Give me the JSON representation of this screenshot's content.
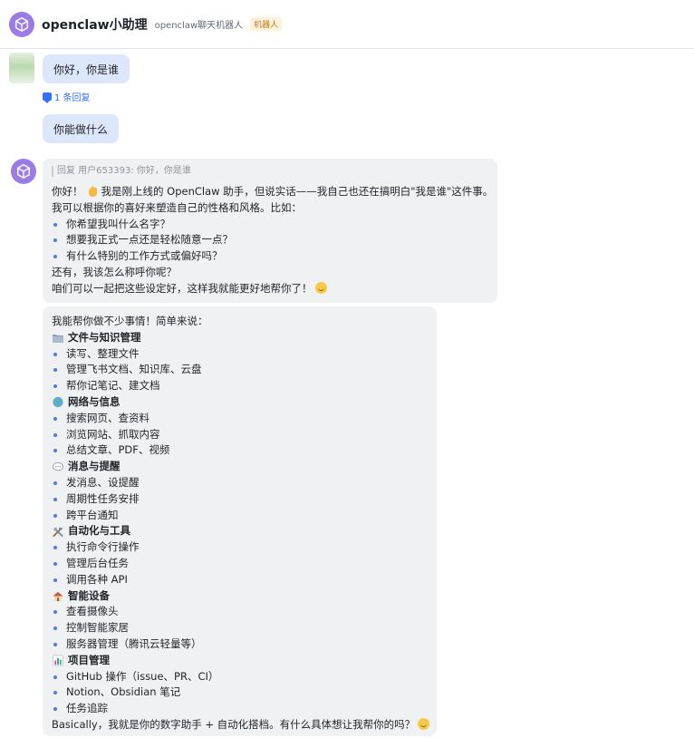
{
  "header": {
    "title": "openclaw小助理",
    "subtitle": "openclaw聊天机器人",
    "badge": "机器人"
  },
  "messages": {
    "user1": "你好，你是谁",
    "reply_count": "1 条回复",
    "user2": "你能做什么"
  },
  "reply1": {
    "quote": "回复 用户653393: 你好，你是谁",
    "greeting_a": "你好！",
    "greeting_b": "我是刚上线的 OpenClaw 助手，但说实话——我自己也还在搞明白\"我是谁\"这件事。",
    "line2": "我可以根据你的喜好来塑造自己的性格和风格。比如：",
    "bullets": [
      "你希望我叫什么名字？",
      "想要我正式一点还是轻松随意一点？",
      "有什么特别的工作方式或偏好吗？"
    ],
    "line3": "还有，我该怎么称呼你呢？",
    "line4": "咱们可以一起把这些设定好，这样我就能更好地帮你了！"
  },
  "reply2": {
    "intro": "我能帮你做不少事情！简单来说：",
    "sections": [
      {
        "title": "文件与知识管理",
        "icon": "folder-icon",
        "items": [
          "读写、整理文件",
          "管理飞书文档、知识库、云盘",
          "帮你记笔记、建文档"
        ]
      },
      {
        "title": "网络与信息",
        "icon": "globe-icon",
        "items": [
          "搜索网页、查资料",
          "浏览网站、抓取内容",
          "总结文章、PDF、视频"
        ]
      },
      {
        "title": "消息与提醒",
        "icon": "speech-bubble-icon",
        "items": [
          "发消息、设提醒",
          "周期性任务安排",
          "跨平台通知"
        ]
      },
      {
        "title": "自动化与工具",
        "icon": "tools-icon",
        "items": [
          "执行命令行操作",
          "管理后台任务",
          "调用各种 API"
        ]
      },
      {
        "title": "智能设备",
        "icon": "house-icon",
        "items": [
          "查看摄像头",
          "控制智能家居",
          "服务器管理（腾讯云轻量等）"
        ]
      },
      {
        "title": "项目管理",
        "icon": "bar-chart-icon",
        "items": [
          "GitHub 操作（issue、PR、CI）",
          "Notion、Obsidian 笔记",
          "任务追踪"
        ]
      }
    ],
    "outro": "Basically，我就是你的数字助手 + 自动化搭档。有什么具体想让我帮你的吗？"
  },
  "colors": {
    "user_bubble": "#dde7fb",
    "bot_bubble": "#f0f1f3",
    "accent": "#3370ff",
    "avatar": "#9b7ce4"
  }
}
